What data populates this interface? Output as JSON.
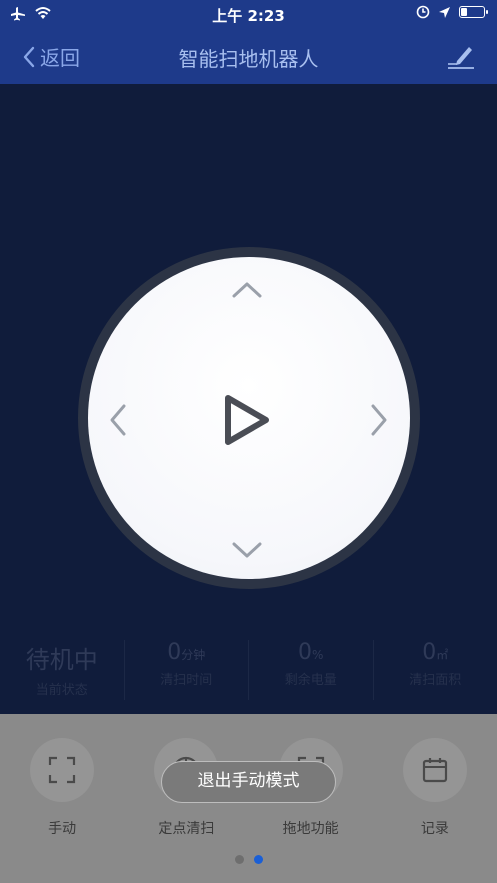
{
  "status_bar": {
    "time": "上午 2:23",
    "battery_level": 0.25
  },
  "nav": {
    "back_label": "返回",
    "title": "智能扫地机器人"
  },
  "stats": [
    {
      "value": "待机中",
      "unit": "",
      "label": "当前状态"
    },
    {
      "value": "0",
      "unit": "分钟",
      "label": "清扫时间"
    },
    {
      "value": "0",
      "unit": "%",
      "label": "剩余电量"
    },
    {
      "value": "0",
      "unit": "㎡",
      "label": "清扫面积"
    }
  ],
  "functions": [
    {
      "label": "手动",
      "icon": "fullscreen-icon"
    },
    {
      "label": "定点清扫",
      "icon": "target-icon"
    },
    {
      "label": "拖地功能",
      "icon": "fullscreen-icon"
    },
    {
      "label": "记录",
      "icon": "calendar-icon"
    }
  ],
  "exit_manual_label": "退出手动模式",
  "pagination": {
    "total": 2,
    "current": 2
  },
  "colors": {
    "nav_bg": "#1e3a8a",
    "main_bg": "#101c3b",
    "dot_active": "#1a5fd6",
    "dot_inactive": "#6e6e6e"
  }
}
